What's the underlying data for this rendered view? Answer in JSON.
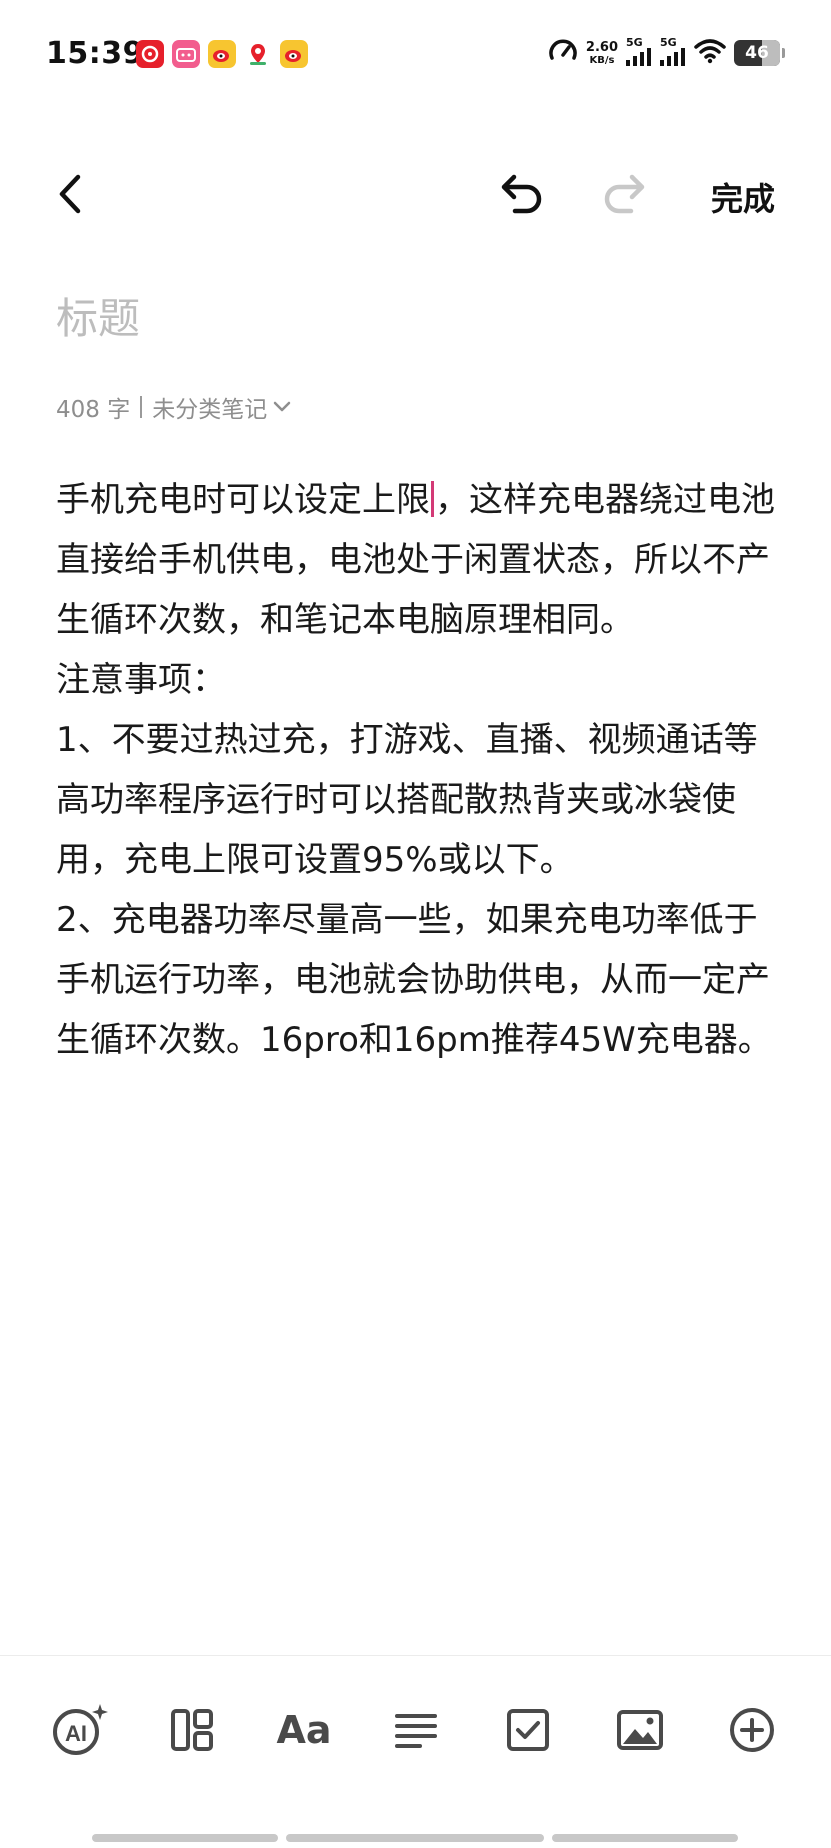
{
  "status_bar": {
    "time": "15:39",
    "net_speed_value": "2.60",
    "net_speed_unit": "KB/s",
    "signal1_label": "5G",
    "signal2_label": "5G",
    "battery_level": "46",
    "notification_icons": [
      "netease-music-icon",
      "bilibili-icon",
      "weibo-icon",
      "map-pin-icon",
      "weibo-icon"
    ]
  },
  "topbar": {
    "done_label": "完成"
  },
  "note": {
    "title_placeholder": "标题",
    "word_count": "408 字",
    "category": "未分类笔记",
    "body_before_caret": "手机充电时可以设定上限",
    "body_after_caret": "，这样充电器绕过电池直接给手机供电，电池处于闲置状态，所以不产生循环次数，和笔记本电脑原理相同。",
    "notes_heading": "注意事项：",
    "item1": "1、不要过热过充，打游戏、直播、视频通话等高功率程序运行时可以搭配散热背夹或冰袋使用，充电上限可设置95%或以下。",
    "item2": "2、充电器功率尽量高一些，如果充电功率低于手机运行功率，电池就会协助供电，从而一定产生循环次数。16pro和16pm推荐45W充电器。"
  },
  "toolbar": {
    "ai_label": "AI",
    "text_style_label": "Aa"
  },
  "colors": {
    "caret": "#d33a76",
    "icon_gray": "#4a4a4a",
    "redo_disabled": "#c8c8c8",
    "placeholder": "#bdbdbd"
  }
}
